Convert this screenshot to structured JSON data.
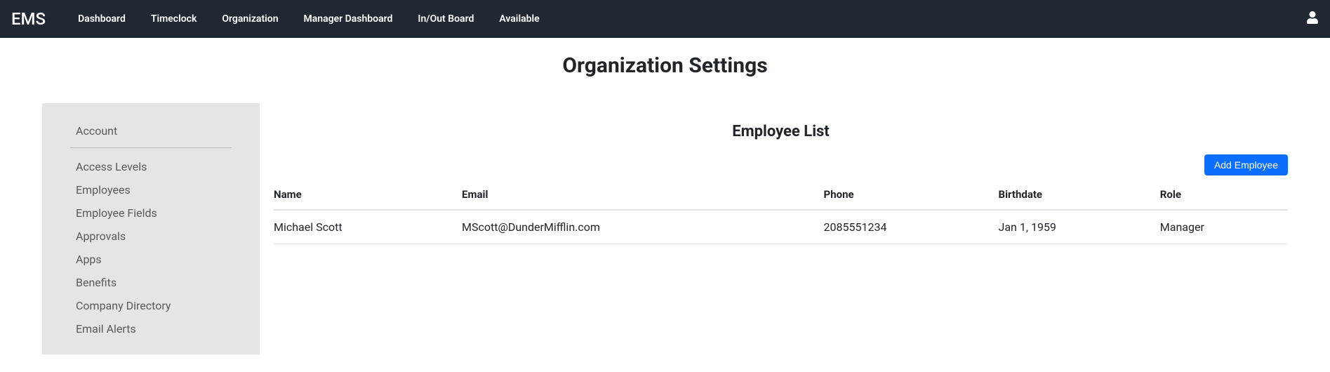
{
  "brand": "EMS",
  "nav": {
    "items": [
      {
        "label": "Dashboard"
      },
      {
        "label": "Timeclock"
      },
      {
        "label": "Organization"
      },
      {
        "label": "Manager Dashboard"
      },
      {
        "label": "In/Out Board"
      },
      {
        "label": "Available"
      }
    ]
  },
  "page_title": "Organization Settings",
  "sidebar": {
    "group_title": "Account",
    "items": [
      {
        "label": "Access Levels"
      },
      {
        "label": "Employees"
      },
      {
        "label": "Employee Fields"
      },
      {
        "label": "Approvals"
      },
      {
        "label": "Apps"
      },
      {
        "label": "Benefits"
      },
      {
        "label": "Company Directory"
      },
      {
        "label": "Email Alerts"
      }
    ]
  },
  "main": {
    "section_title": "Employee List",
    "add_button_label": "Add Employee",
    "table": {
      "columns": [
        "Name",
        "Email",
        "Phone",
        "Birthdate",
        "Role"
      ],
      "rows": [
        {
          "name": "Michael Scott",
          "email": "MScott@DunderMifflin.com",
          "phone": "2085551234",
          "birthdate": "Jan 1, 1959",
          "role": "Manager"
        }
      ]
    }
  }
}
